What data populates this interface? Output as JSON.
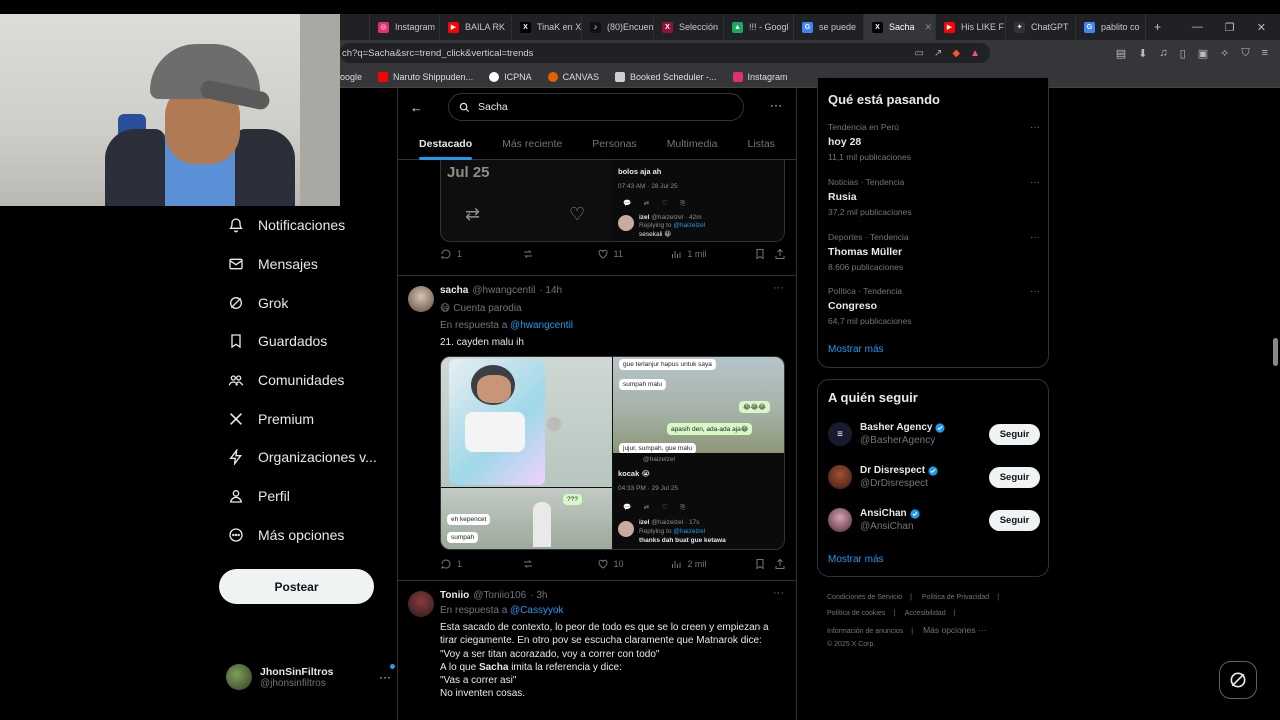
{
  "browser": {
    "tabs": [
      {
        "label": "",
        "fav_color": "#444"
      },
      {
        "label": "Instagram",
        "fav_color": "#e1306c",
        "fav_glyph": "◎"
      },
      {
        "label": "BAILA RK",
        "fav_color": "#ff0000",
        "fav_glyph": "▶"
      },
      {
        "label": "TinaK en X",
        "fav_color": "#000000",
        "fav_glyph": "X"
      },
      {
        "label": "(80)Encuen",
        "fav_color": "#111111",
        "fav_glyph": "♪"
      },
      {
        "label": "Selección",
        "fav_color": "#8a1538",
        "fav_glyph": "X"
      },
      {
        "label": "!!! - Googl",
        "fav_color": "#1fa463",
        "fav_glyph": "▲"
      },
      {
        "label": "se puede",
        "fav_color": "#4285f4",
        "fav_glyph": "G"
      },
      {
        "label": "Sacha",
        "fav_color": "#000000",
        "fav_glyph": "X"
      },
      {
        "label": "His LIKE F",
        "fav_color": "#ff0000",
        "fav_glyph": "▶"
      },
      {
        "label": "ChatGPT",
        "fav_color": "#333333",
        "fav_glyph": "✦"
      },
      {
        "label": "pablito co",
        "fav_color": "#4285f4",
        "fav_glyph": "G"
      }
    ],
    "url": "ch?q=Sacha&src=trend_click&vertical=trends",
    "bookmarks": [
      {
        "label": "oogle",
        "color": "#4285f4"
      },
      {
        "label": "Naruto Shippuden...",
        "color": "#ff0000"
      },
      {
        "label": "ICPNA",
        "color": "#ffffff"
      },
      {
        "label": "CANVAS",
        "color": "#e66000"
      },
      {
        "label": "Booked Scheduler -...",
        "color": "#1c1c1c"
      },
      {
        "label": "Instagram",
        "color": "#e1306c"
      }
    ]
  },
  "nav": {
    "items": [
      {
        "label": "Notificaciones",
        "icon": "bell-icon"
      },
      {
        "label": "Mensajes",
        "icon": "mail-icon"
      },
      {
        "label": "Grok",
        "icon": "grok-icon"
      },
      {
        "label": "Guardados",
        "icon": "bookmark-icon"
      },
      {
        "label": "Comunidades",
        "icon": "communities-icon"
      },
      {
        "label": "Premium",
        "icon": "x-logo-icon"
      },
      {
        "label": "Organizaciones v...",
        "icon": "lightning-icon"
      },
      {
        "label": "Perfil",
        "icon": "person-icon"
      },
      {
        "label": "Más opciones",
        "icon": "more-circle-icon"
      }
    ],
    "post_label": "Postear",
    "account_name": "JhonSinFiltros",
    "account_handle": "@jhonsinfiltros"
  },
  "search": {
    "value": "Sacha"
  },
  "tabs": [
    "Destacado",
    "Más reciente",
    "Personas",
    "Multimedia",
    "Listas"
  ],
  "tweet0": {
    "quote_date": "Jul 25",
    "mini_text": "bolos aja ah",
    "mini_meta": "07:43 AM · 28 Jul 25",
    "mini_reply_name": "izel",
    "mini_reply_handle": "@haizelzel · 42m",
    "mini_replying": "Replying to",
    "mini_replying_to": "@haizelzel",
    "mini_reply_text": "sesekali 😀",
    "replies": "1",
    "likes": "11",
    "views": "1 mil"
  },
  "tweet1": {
    "name": "sacha",
    "handle": "@hwangcentil",
    "time": "· 14h",
    "parody": "Cuenta parodia",
    "reply_prefix": "En respuesta a",
    "reply_to": "@hwangcentil",
    "text": "21. cayden malu ih",
    "bubbles_top": [
      "gue terlanjur hapus untuk saya",
      "sumpah malu",
      "😂😂😂",
      "apasih den, ada-ada aja😂",
      "jujur, sumpah, gue malu"
    ],
    "mini_user": "@haizelzel",
    "mini_text": "kocak 😭",
    "mini_meta": "04:33 PM · 29 Jul 25",
    "mini_reply_name": "izel",
    "mini_reply_handle": "@haizelzel · 17s",
    "mini_replying": "Replying to",
    "mini_replying_to": "@haizelzel",
    "mini_reply_text": "thanks dah buat gue ketawa",
    "bubbles_bottom": [
      "???",
      "eh kepencet",
      "sumpah"
    ],
    "replies": "1",
    "likes": "10",
    "views": "2 mil"
  },
  "tweet2": {
    "name": "Toniio",
    "handle": "@Toniio106",
    "time": "· 3h",
    "reply_prefix": "En respuesta a",
    "reply_to": "@Cassyyok",
    "line1": "Esta sacado de contexto, lo peor de todo es que se lo creen y empiezan a",
    "line2": "tirar ciegamente. En otro pov se escucha claramente que Matnarok dice:",
    "line3": "\"Voy a ser titan acorazado, voy a correr con todo\"",
    "line4a": "A lo que",
    "line4b": "Sacha",
    "line4c": "imita la referencia y dice:",
    "line5": "\"Vas a correr asi\"",
    "line6": "No inventen cosas."
  },
  "trending": {
    "title": "Qué está pasando",
    "items": [
      {
        "category": "Tendencia en Perú",
        "name": "hoy 28",
        "count": "11,1 mil publicaciones"
      },
      {
        "category": "Noticias · Tendencia",
        "name": "Rusia",
        "count": "37,2 mil publicaciones"
      },
      {
        "category": "Deportes · Tendencia",
        "name": "Thomas Müller",
        "count": "8.606 publicaciones"
      },
      {
        "category": "Política · Tendencia",
        "name": "Congreso",
        "count": "64,7 mil publicaciones"
      }
    ],
    "show_more": "Mostrar más"
  },
  "who_to_follow": {
    "title": "A quién seguir",
    "items": [
      {
        "name": "Basher Agency",
        "handle": "@BasherAgency",
        "button": "Seguir",
        "avatar": "#1a1a2e"
      },
      {
        "name": "Dr Disrespect",
        "handle": "@DrDisrespect",
        "button": "Seguir",
        "avatar": "#5a2a2a"
      },
      {
        "name": "AnsiChan",
        "handle": "@AnsiChan",
        "button": "Seguir",
        "avatar": "#6a4a5a"
      }
    ],
    "show_more": "Mostrar más"
  },
  "footer": {
    "links": [
      "Condiciones de Servicio",
      "Política de Privacidad",
      "Política de cookies",
      "Accesibilidad",
      "Información de anuncios",
      "Más opciones ···"
    ],
    "copyright": "© 2025 X Corp."
  },
  "colors": {
    "accent": "#1d9bf0",
    "bg": "#000000",
    "border": "#2f3336"
  }
}
